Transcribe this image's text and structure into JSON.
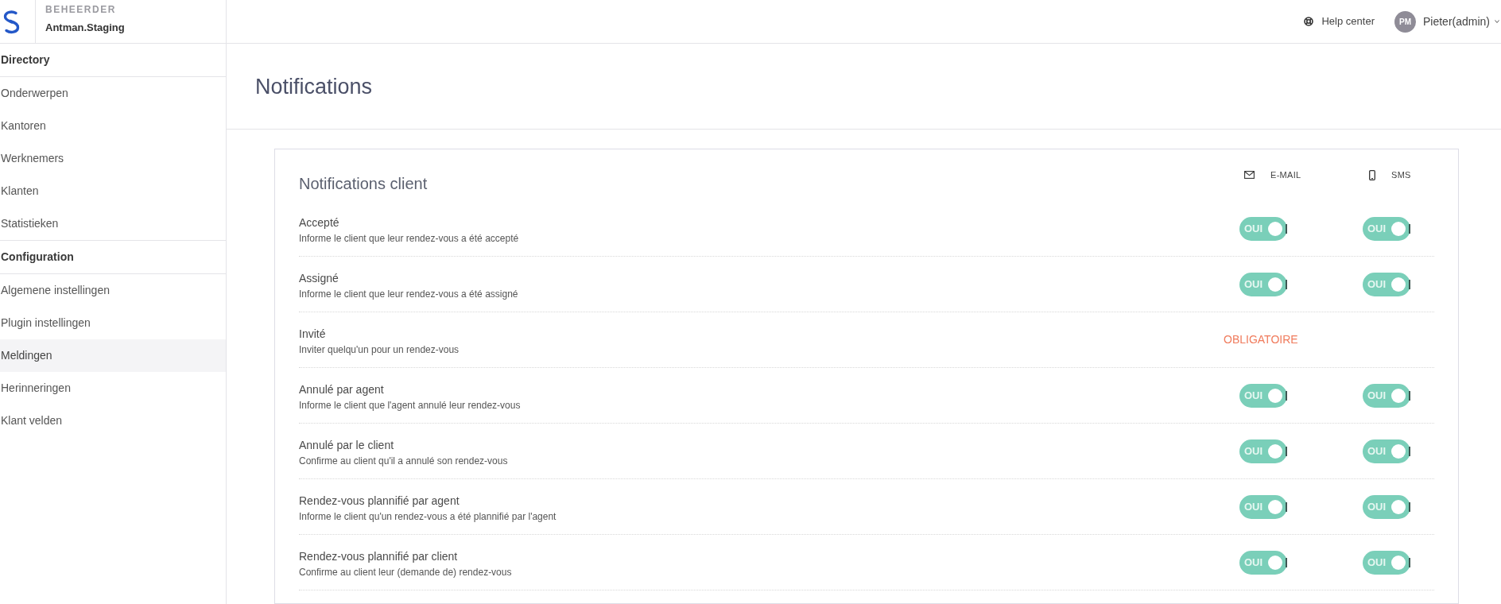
{
  "header": {
    "role_label": "BEHEERDER",
    "workspace": "Antman.Staging",
    "help_link": "Help center",
    "user": {
      "initials": "PM",
      "name": "Pieter(admin)"
    }
  },
  "sidebar": {
    "sections": [
      {
        "title": "Directory",
        "items": [
          {
            "label": "Onderwerpen",
            "selected": false
          },
          {
            "label": "Kantoren",
            "selected": false
          },
          {
            "label": "Werknemers",
            "selected": false
          },
          {
            "label": "Klanten",
            "selected": false
          },
          {
            "label": "Statistieken",
            "selected": false
          }
        ]
      },
      {
        "title": "Configuration",
        "items": [
          {
            "label": "Algemene instellingen",
            "selected": false
          },
          {
            "label": "Plugin instellingen",
            "selected": false
          },
          {
            "label": "Meldingen",
            "selected": true
          },
          {
            "label": "Herinneringen",
            "selected": false
          },
          {
            "label": "Klant velden",
            "selected": false
          }
        ]
      }
    ]
  },
  "page": {
    "title": "Notifications"
  },
  "card": {
    "title": "Notifications client",
    "columns": [
      {
        "kind": "email",
        "label": "E-MAIL"
      },
      {
        "kind": "sms",
        "label": "SMS"
      }
    ],
    "rows": [
      {
        "title": "Accepté",
        "description": "Informe le client que leur rendez-vous a été accepté",
        "cells": [
          {
            "kind": "toggle",
            "on": true,
            "label": "OUI"
          },
          {
            "kind": "toggle",
            "on": true,
            "label": "OUI"
          }
        ]
      },
      {
        "title": "Assigné",
        "description": "Informe le client que leur rendez-vous a été assigné",
        "cells": [
          {
            "kind": "toggle",
            "on": true,
            "label": "OUI"
          },
          {
            "kind": "toggle",
            "on": true,
            "label": "OUI"
          }
        ]
      },
      {
        "title": "Invité",
        "description": "Inviter quelqu'un pour un rendez-vous",
        "cells": [
          {
            "kind": "required",
            "label": "OBLIGATOIRE"
          }
        ]
      },
      {
        "title": "Annulé par agent",
        "description": "Informe le client que l'agent annulé leur rendez-vous",
        "cells": [
          {
            "kind": "toggle",
            "on": true,
            "label": "OUI"
          },
          {
            "kind": "toggle",
            "on": true,
            "label": "OUI"
          }
        ]
      },
      {
        "title": "Annulé par le client",
        "description": "Confirme au client qu'il a annulé son rendez-vous",
        "cells": [
          {
            "kind": "toggle",
            "on": true,
            "label": "OUI"
          },
          {
            "kind": "toggle",
            "on": true,
            "label": "OUI"
          }
        ]
      },
      {
        "title": "Rendez-vous plannifié par agent",
        "description": "Informe le client qu'un rendez-vous a été plannifié par l'agent",
        "cells": [
          {
            "kind": "toggle",
            "on": true,
            "label": "OUI"
          },
          {
            "kind": "toggle",
            "on": true,
            "label": "OUI"
          }
        ]
      },
      {
        "title": "Rendez-vous plannifié par client",
        "description": "Confirme au client leur (demande de) rendez-vous",
        "cells": [
          {
            "kind": "toggle",
            "on": true,
            "label": "OUI"
          },
          {
            "kind": "toggle",
            "on": true,
            "label": "OUI"
          }
        ]
      }
    ]
  }
}
